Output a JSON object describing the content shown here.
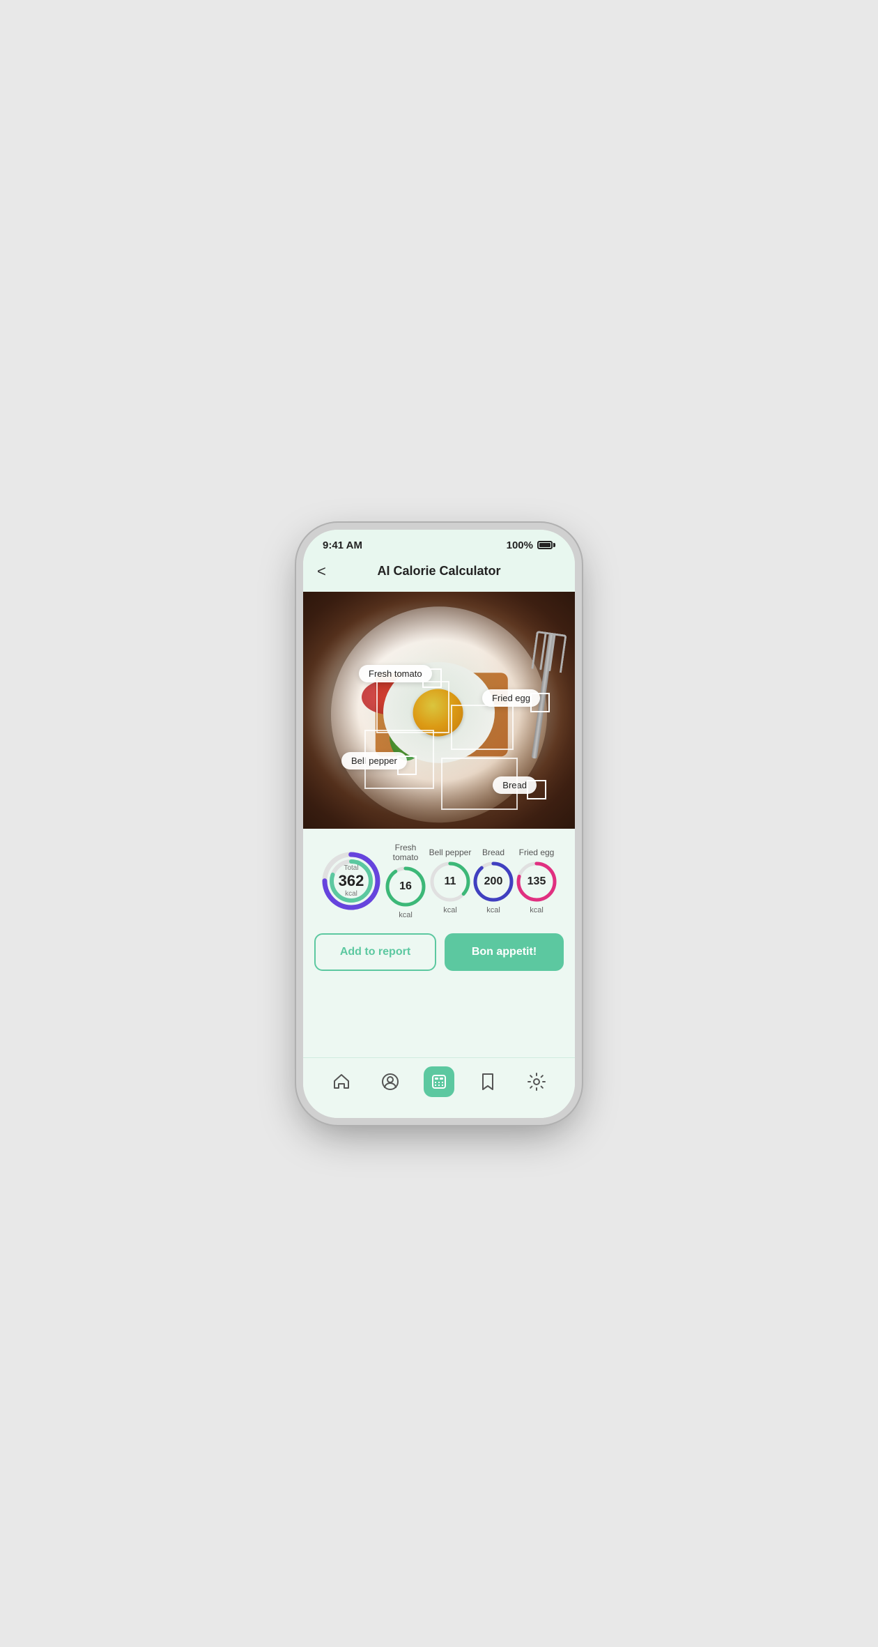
{
  "statusBar": {
    "time": "9:41 AM",
    "battery": "100%"
  },
  "header": {
    "title": "AI Calorie Calculator",
    "backLabel": "<"
  },
  "detectionLabels": {
    "freshTomato": "Fresh tomato",
    "friedEgg": "Fried egg",
    "bellPepper": "Bell pepper",
    "bread": "Bread"
  },
  "calories": {
    "total": {
      "label": "Total",
      "value": "362",
      "unit": "kcal"
    },
    "items": [
      {
        "name": "Fresh tomato",
        "value": "16",
        "unit": "kcal",
        "color": "#3cb878"
      },
      {
        "name": "Bell pepper",
        "value": "11",
        "unit": "kcal",
        "color": "#3cb878"
      },
      {
        "name": "Bread",
        "value": "200",
        "unit": "kcal",
        "color": "#4040c0"
      },
      {
        "name": "Fried egg",
        "value": "135",
        "unit": "kcal",
        "color": "#e03080"
      }
    ]
  },
  "buttons": {
    "addReport": "Add to report",
    "bonAppetit": "Bon appetit!"
  },
  "bottomNav": [
    {
      "name": "home",
      "icon": "home",
      "active": false
    },
    {
      "name": "profile",
      "icon": "person",
      "active": false
    },
    {
      "name": "calculator",
      "icon": "calculator",
      "active": true
    },
    {
      "name": "bookmarks",
      "icon": "bookmark",
      "active": false
    },
    {
      "name": "settings",
      "icon": "gear",
      "active": false
    }
  ],
  "colors": {
    "accent": "#5cc8a0",
    "bg": "#edf8f2",
    "totalRingOuter": "#6644dd",
    "totalRingInner": "#5cc8a0"
  }
}
